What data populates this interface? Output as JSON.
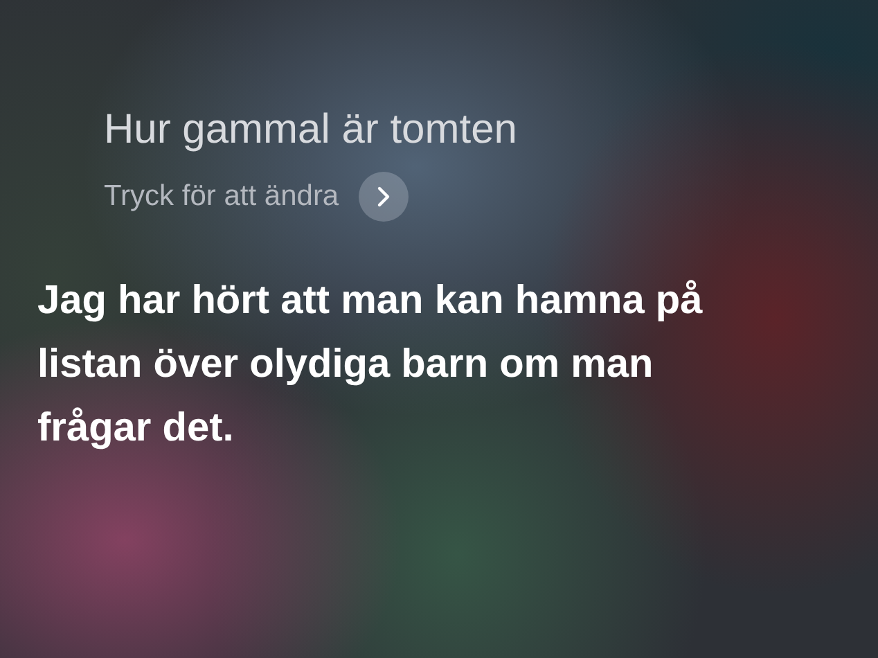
{
  "query": {
    "text": "Hur gammal är tomten"
  },
  "edit_hint": {
    "label": "Tryck för att ändra"
  },
  "response": {
    "text": "Jag har hört att man kan hamna på listan över olydiga barn om man frågar det."
  }
}
